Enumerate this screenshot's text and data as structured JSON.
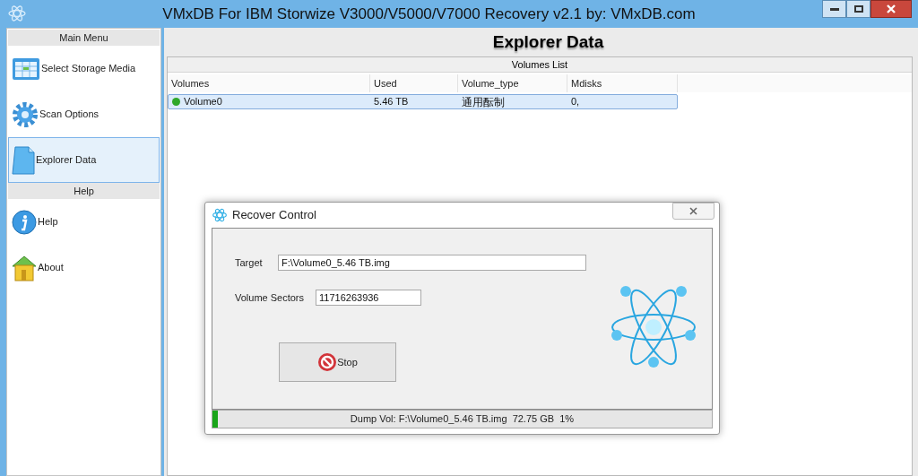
{
  "window": {
    "title": "VMxDB For IBM Storwize V3000/V5000/V7000 Recovery v2.1 by: VMxDB.com"
  },
  "sidebar": {
    "sections": [
      {
        "header": "Main Menu",
        "items": [
          {
            "label": "Select Storage Media",
            "kind": "grid",
            "selected": false
          },
          {
            "label": "Scan Options",
            "kind": "gear",
            "selected": false
          },
          {
            "label": "Explorer Data",
            "kind": "document",
            "selected": true
          }
        ]
      },
      {
        "header": "Help",
        "items": [
          {
            "label": "Help",
            "kind": "info",
            "selected": false
          },
          {
            "label": "About",
            "kind": "house",
            "selected": false
          }
        ]
      }
    ]
  },
  "page_title": "Explorer Data",
  "table": {
    "caption": "Volumes List",
    "columns": [
      "Volumes",
      "Used",
      "Volume_type",
      "Mdisks"
    ],
    "rows": [
      {
        "selected": true,
        "color": "#2fa82a",
        "cells": [
          "Volume0",
          "5.46 TB",
          "通用酝制",
          "0,"
        ]
      }
    ]
  },
  "dialog": {
    "title": "Recover Control",
    "fields": [
      {
        "label": "Target",
        "value": "F:\\Volume0_5.46 TB.img"
      },
      {
        "label": "Volume Sectors",
        "value": "11716263936"
      }
    ],
    "button": "Stop",
    "progress": {
      "level": 0.01,
      "text": "Dump Vol: F:\\Volume0_5.46 TB.img  72.75 GB  1%"
    }
  }
}
